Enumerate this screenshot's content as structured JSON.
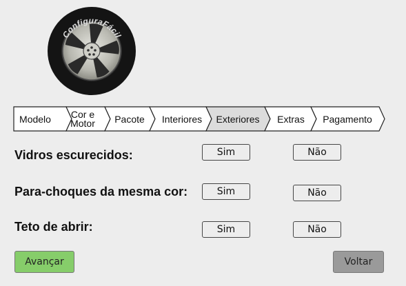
{
  "logo": {
    "text": "ConfiguraFácil",
    "icon": "tire-wheel-icon"
  },
  "steps": [
    {
      "label": "Modelo",
      "active": false
    },
    {
      "label": "Cor e\nMotor",
      "active": false
    },
    {
      "label": "Pacote",
      "active": false
    },
    {
      "label": "Interiores",
      "active": false
    },
    {
      "label": "Exteriores",
      "active": true
    },
    {
      "label": "Extras",
      "active": false
    },
    {
      "label": "Pagamento",
      "active": false
    }
  ],
  "colors": {
    "active_step": "#dcdcdc",
    "step_fill": "#ffffff",
    "next_button": "#86cd6a",
    "back_button": "#9a9a9a"
  },
  "questions": [
    {
      "label": "Vidros escurecidos:",
      "yes": "Sim",
      "no": "Não"
    },
    {
      "label": "Para-choques da mesma cor:",
      "yes": "Sim",
      "no": "Não"
    },
    {
      "label": "Teto de abrir:",
      "yes": "Sim",
      "no": "Não"
    }
  ],
  "buttons": {
    "next": "Avançar",
    "back": "Voltar"
  }
}
